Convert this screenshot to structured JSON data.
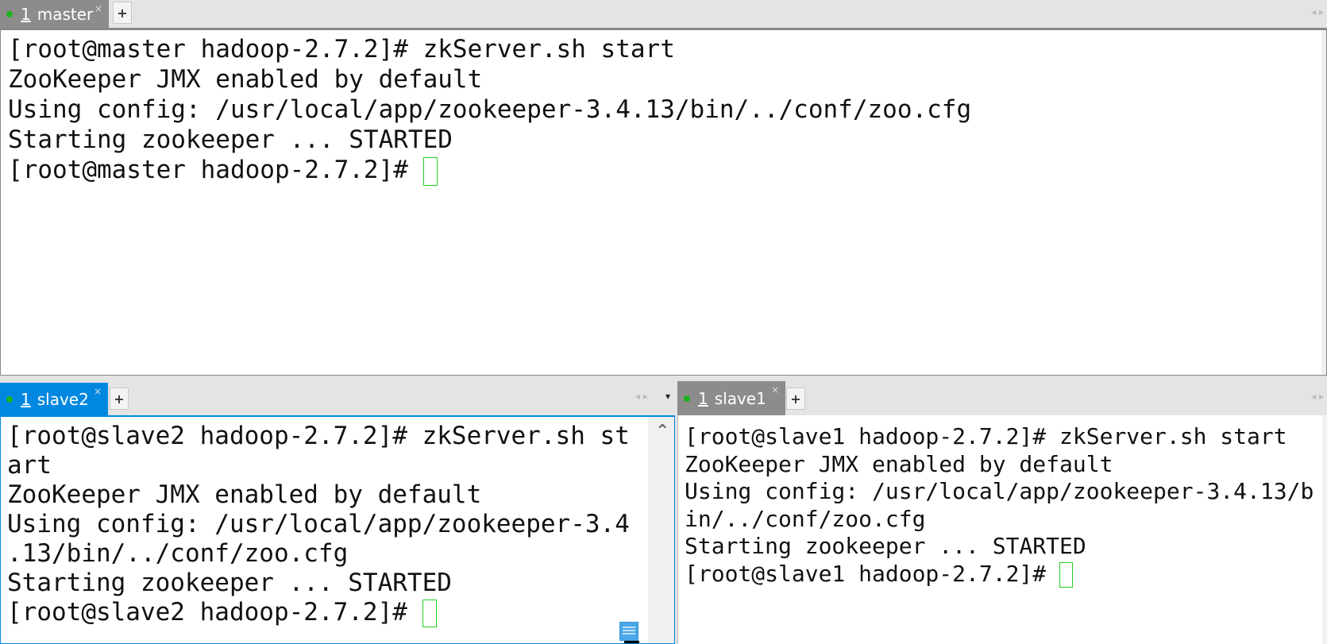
{
  "colors": {
    "active_tab": "#0088e0",
    "inactive_tab": "#8c8c8c",
    "status_dot": "#1db31d",
    "cursor": "#22d022"
  },
  "panes": [
    {
      "tab": {
        "number": "1",
        "label": "master",
        "close": "×",
        "add": "+"
      },
      "lines": [
        "[root@master hadoop-2.7.2]# zkServer.sh start",
        "ZooKeeper JMX enabled by default",
        "Using config: /usr/local/app/zookeeper-3.4.13/bin/../conf/zoo.cfg",
        "Starting zookeeper ... STARTED"
      ],
      "prompt": "[root@master hadoop-2.7.2]# "
    },
    {
      "tab": {
        "number": "1",
        "label": "slave2",
        "close": "×",
        "add": "+"
      },
      "lines": [
        "[root@slave2 hadoop-2.7.2]# zkServer.sh st",
        "art",
        "ZooKeeper JMX enabled by default",
        "Using config: /usr/local/app/zookeeper-3.4",
        ".13/bin/../conf/zoo.cfg",
        "Starting zookeeper ... STARTED"
      ],
      "prompt": "[root@slave2 hadoop-2.7.2]# "
    },
    {
      "tab": {
        "number": "1",
        "label": "slave1",
        "close": "×",
        "add": "+"
      },
      "lines": [
        "[root@slave1 hadoop-2.7.2]# zkServer.sh start",
        "ZooKeeper JMX enabled by default",
        "Using config: /usr/local/app/zookeeper-3.4.13/b",
        "in/../conf/zoo.cfg",
        "Starting zookeeper ... STARTED"
      ],
      "prompt": "[root@slave1 hadoop-2.7.2]# "
    }
  ],
  "icons": {
    "nav": "◂ ▸",
    "menu": "▾",
    "scroll_up": "⌃"
  }
}
